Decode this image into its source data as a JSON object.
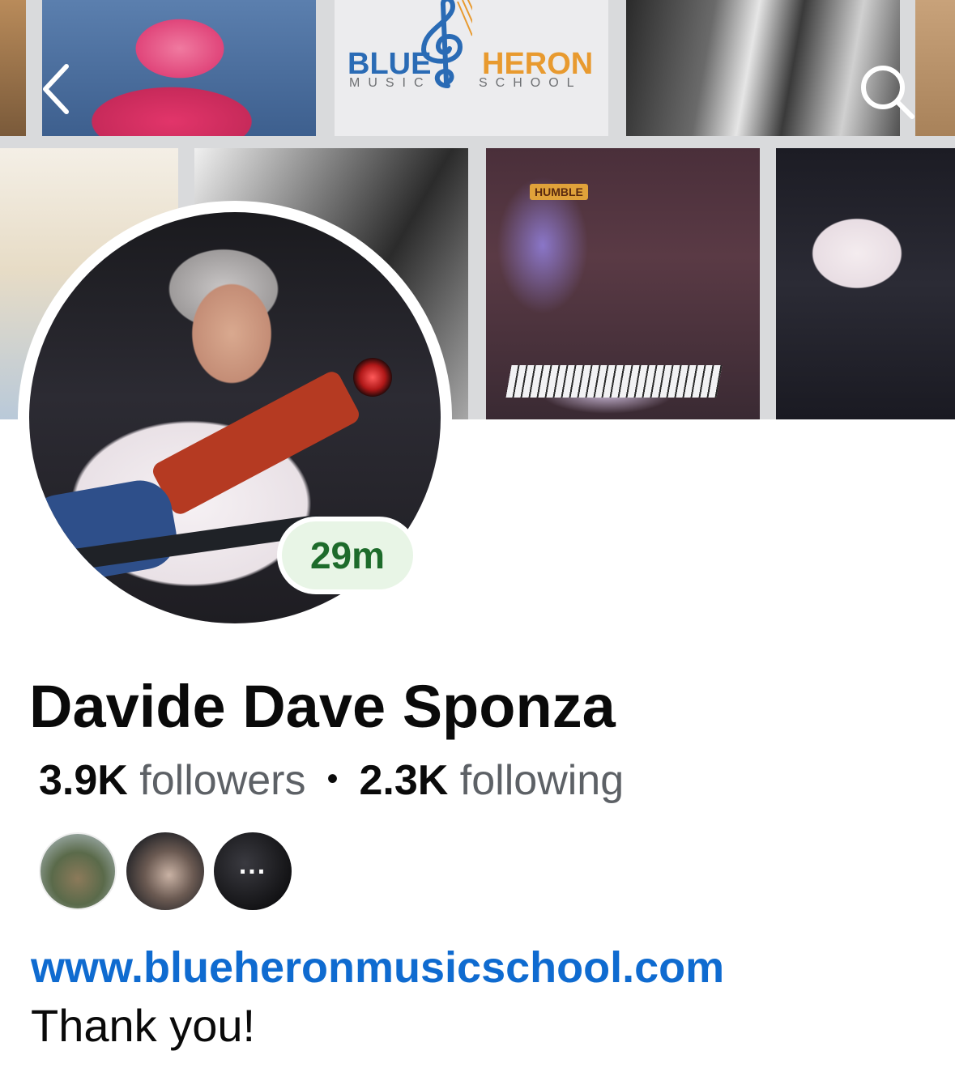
{
  "cover": {
    "logo": {
      "word_left": "BLUE",
      "word_right": "HERON",
      "sub_left": "MUSIC",
      "sub_right": "SCHOOL",
      "color_blue": "#2a6bb5",
      "color_orange": "#e89a2f"
    },
    "photo_sign": "HUMBLE"
  },
  "nav": {
    "back_icon": "chevron-left-icon",
    "search_icon": "search-icon"
  },
  "profile": {
    "active_badge": "29m",
    "name": "Davide Dave Sponza",
    "followers_count": "3.9K",
    "followers_label": "followers",
    "separator": "•",
    "following_count": "2.3K",
    "following_label": "following",
    "mutual_more": "...",
    "website": "www.blueheronmusicschool.com",
    "bio": "Thank you!"
  },
  "colors": {
    "link": "#0f6bd0",
    "badge_text": "#1d6b2b",
    "badge_bg": "#e8f5e6"
  }
}
